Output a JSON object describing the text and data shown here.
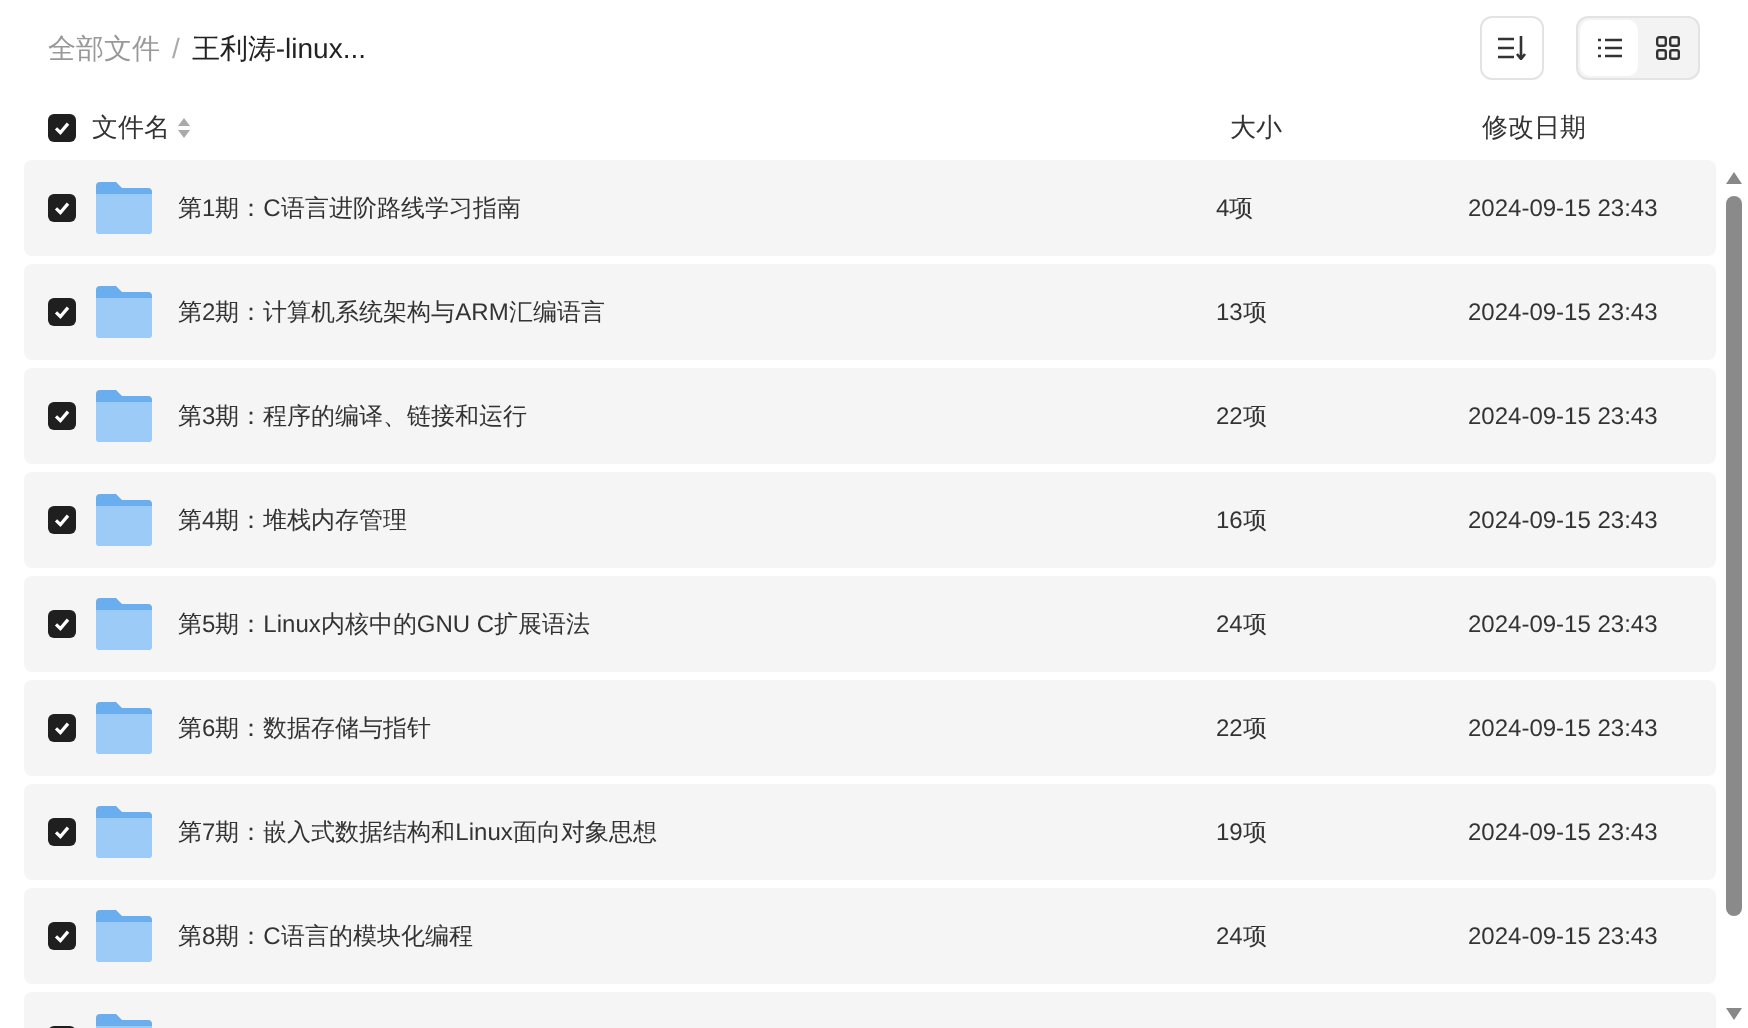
{
  "breadcrumb_separator": "/",
  "breadcrumb": [
    {
      "label": "全部文件",
      "current": false
    },
    {
      "label": "王利涛-linux...",
      "current": true
    }
  ],
  "view_toggle": [
    {
      "kind": "list",
      "selected": true
    },
    {
      "kind": "grid",
      "selected": false
    }
  ],
  "header": {
    "checked": true,
    "columns": [
      "文件名",
      "大小",
      "修改日期"
    ]
  },
  "rows": [
    {
      "checked": true,
      "name": "第1期：C语言进阶路线学习指南",
      "size": "4项",
      "date": "2024-09-15 23:43"
    },
    {
      "checked": true,
      "name": "第2期：计算机系统架构与ARM汇编语言",
      "size": "13项",
      "date": "2024-09-15 23:43"
    },
    {
      "checked": true,
      "name": "第3期：程序的编译、链接和运行",
      "size": "22项",
      "date": "2024-09-15 23:43"
    },
    {
      "checked": true,
      "name": "第4期：堆栈内存管理",
      "size": "16项",
      "date": "2024-09-15 23:43"
    },
    {
      "checked": true,
      "name": "第5期：Linux内核中的GNU C扩展语法",
      "size": "24项",
      "date": "2024-09-15 23:43"
    },
    {
      "checked": true,
      "name": "第6期：数据存储与指针",
      "size": "22项",
      "date": "2024-09-15 23:43"
    },
    {
      "checked": true,
      "name": "第7期：嵌入式数据结构和Linux面向对象思想",
      "size": "19项",
      "date": "2024-09-15 23:43"
    },
    {
      "checked": true,
      "name": "第8期：C语言的模块化编程",
      "size": "24项",
      "date": "2024-09-15 23:43"
    },
    {
      "checked": true
    }
  ]
}
